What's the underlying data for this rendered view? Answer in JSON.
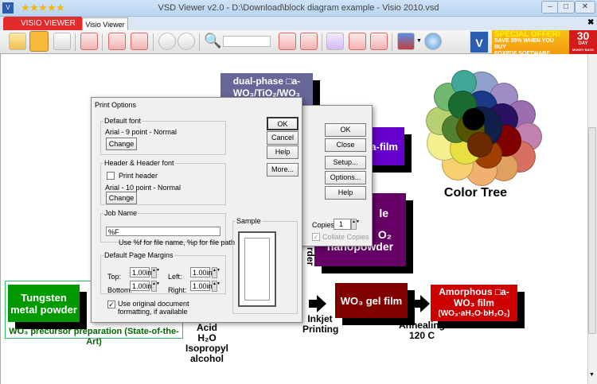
{
  "window": {
    "title": "VSD Viewer v2.0 - D:\\Download\\block diagram example - Visio 2010.vsd",
    "rating_stars": 5
  },
  "tabs": {
    "app_menu": "VISIO VIEWER",
    "active_tab": "Visio Viewer"
  },
  "toolbar": {
    "search_value": "",
    "offer_line1": "SPECIAL OFFER!",
    "offer_line2": "SAVE 35% WHEN YOU BUY",
    "offer_line3": "FOXPDF SOFTWARE LICENSES.",
    "badge_number": "30",
    "badge_day": "DAY",
    "badge_sub": "MONEY BACK GUARANTEE"
  },
  "diagram": {
    "dual_phase": "dual-phase □a-WO₃/TiO₂/WO₃ □film",
    "purple_film": "□a-film",
    "nanopowder_top": "le",
    "nanopowder_mid": "O₂",
    "nanopowder_bottom": "nanopowder",
    "tungsten": "Tungsten metal powder",
    "precursor_label": "WO₃ precursor preparation (State-of-the-Art)",
    "acid": "Acid",
    "h2o": "H₂O",
    "isopropyl": "Isopropyl",
    "alcohol": "alcohol",
    "inkjet": "Inkjet",
    "printing": "Printing",
    "order_fragment": "rder",
    "gel_film": "WO₃ gel film",
    "annealing": "Annealing",
    "temp": "120 C",
    "amorphous_1": "Amorphous □a-",
    "amorphous_2": "WO₃ film",
    "amorphous_3": "(WO₃·aH₂O·bH₂O₂)",
    "color_tree": "Color Tree"
  },
  "print_dialog": {
    "ok": "OK",
    "close": "Close",
    "setup": "Setup...",
    "options": "Options...",
    "help": "Help",
    "copies_label": "Copies:",
    "copies": "1",
    "collate": "Collate Copies",
    "collate_checked": true
  },
  "options_dialog": {
    "title": "Print Options",
    "default_font_legend": "Default font",
    "default_font": "Arial - 9 point - Normal",
    "change": "Change",
    "header_legend": "Header & Header font",
    "print_header": "Print header",
    "print_header_checked": false,
    "header_font": "Arial - 10 point - Normal",
    "job_legend": "Job Name",
    "job_value": "%F",
    "job_hint": "Use %f for file name, %p for file path",
    "margins_legend": "Default Page Margins",
    "top_label": "Top:",
    "top": "1.00in",
    "left_label": "Left:",
    "left": "1.00in",
    "bottom_label": "Bottom:",
    "bottom": "1.00in",
    "right_label": "Right:",
    "right": "1.00in",
    "use_original": "Use original document formatting, if available",
    "use_original_checked": true,
    "sample_legend": "Sample",
    "ok": "OK",
    "cancel": "Cancel",
    "help": "Help",
    "more": "More..."
  }
}
